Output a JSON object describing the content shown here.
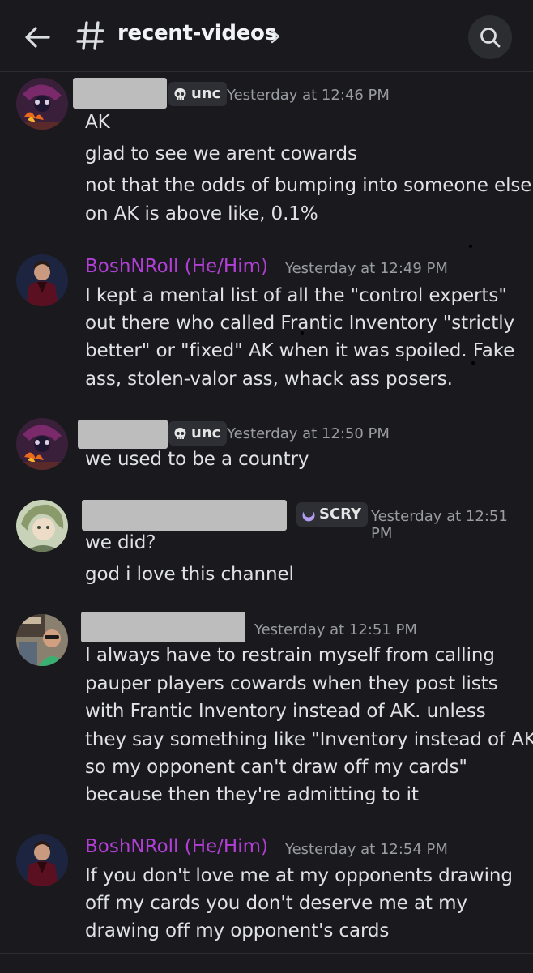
{
  "header": {
    "back_icon": "arrow-left-icon",
    "hash_icon": "hash-icon",
    "channel": "recent-videos",
    "chevron_icon": "chevron-right-icon",
    "search_icon": "search-icon"
  },
  "messages": [
    {
      "author": "",
      "role_tag": "unc",
      "role_icon": "skull-icon",
      "time": "Yesterday at 12:46 PM",
      "lines": [
        "AK",
        "glad to see we arent cowards",
        "not that the odds of bumping into someone else",
        "on AK is above like, 0.1%"
      ]
    },
    {
      "author": "BoshNRoll (He/Him)",
      "time": "Yesterday at 12:49 PM",
      "lines": [
        "I kept a mental list of all the \"control experts\"",
        "out there who called Frantic Inventory \"strictly",
        "better\" or \"fixed\" AK when it was spoiled. Fake",
        "ass, stolen-valor ass, whack ass posers."
      ]
    },
    {
      "author": "",
      "role_tag": "unc",
      "role_icon": "skull-icon",
      "time": "Yesterday at 12:50 PM",
      "lines": [
        "we used to be a country"
      ]
    },
    {
      "author": "",
      "role_tag": "SCRY",
      "role_icon": "crescent-moon-icon",
      "time": "Yesterday at 12:51 PM",
      "lines": [
        "we did?",
        "god i love this channel"
      ]
    },
    {
      "author": "",
      "time": "Yesterday at 12:51 PM",
      "lines": [
        "I always have to restrain myself from calling",
        "pauper players cowards when they post lists",
        "with Frantic Inventory instead of AK. unless",
        "they say something like \"Inventory instead of AK",
        "so my opponent can't draw off my cards\"",
        "because then they're admitting to it"
      ]
    },
    {
      "author": "BoshNRoll (He/Him)",
      "time": "Yesterday at 12:54 PM",
      "lines": [
        "If you don't love me at my opponents drawing",
        "off my cards you don't deserve me at my",
        "drawing off my opponent's cards"
      ]
    }
  ],
  "colors": {
    "background": "#1a1a1e",
    "author_name": "#b13fd6",
    "timestamp": "#9a9ca3",
    "text": "#e0e1e5",
    "redaction": "#bdbdbd"
  }
}
